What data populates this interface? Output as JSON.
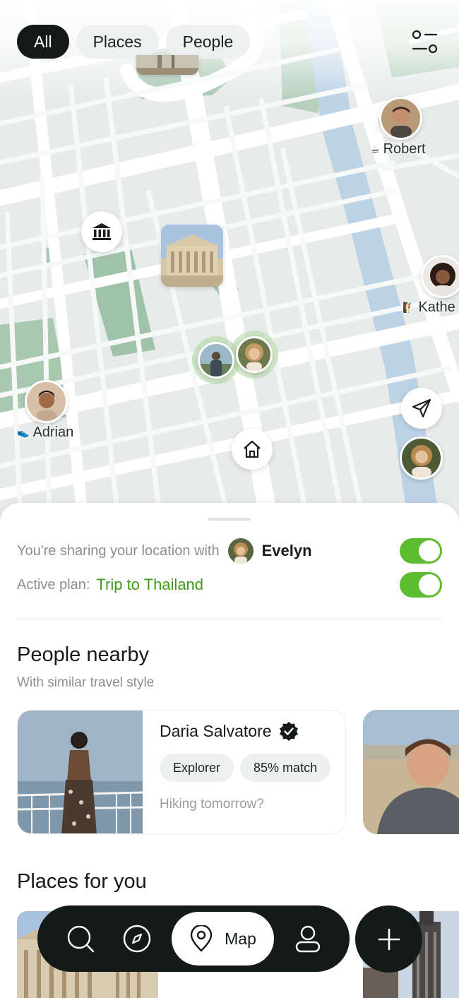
{
  "filters": {
    "all": "All",
    "places": "Places",
    "people": "People"
  },
  "map_people": {
    "robert": {
      "name": "Robert",
      "emoji": "☕"
    },
    "kathe": {
      "name": "Kathe",
      "emoji": "🧗"
    },
    "adrian": {
      "name": "Adrian",
      "emoji": "👟"
    }
  },
  "sheet": {
    "sharing_text": "You're sharing your location with",
    "sharing_name": "Evelyn",
    "plan_label": "Active plan:",
    "plan_value": "Trip to Thailand",
    "people_title": "People nearby",
    "people_subtitle": "With similar travel style",
    "person": {
      "name": "Daria Salvatore",
      "tags": [
        "Explorer",
        "85% match"
      ],
      "message": "Hiking tomorrow?"
    },
    "places_title": "Places for you"
  },
  "nav": {
    "map_label": "Map"
  },
  "colors": {
    "accent_green": "#5cbd2f",
    "plan_green": "#3e9a18",
    "dark": "#141a18"
  }
}
